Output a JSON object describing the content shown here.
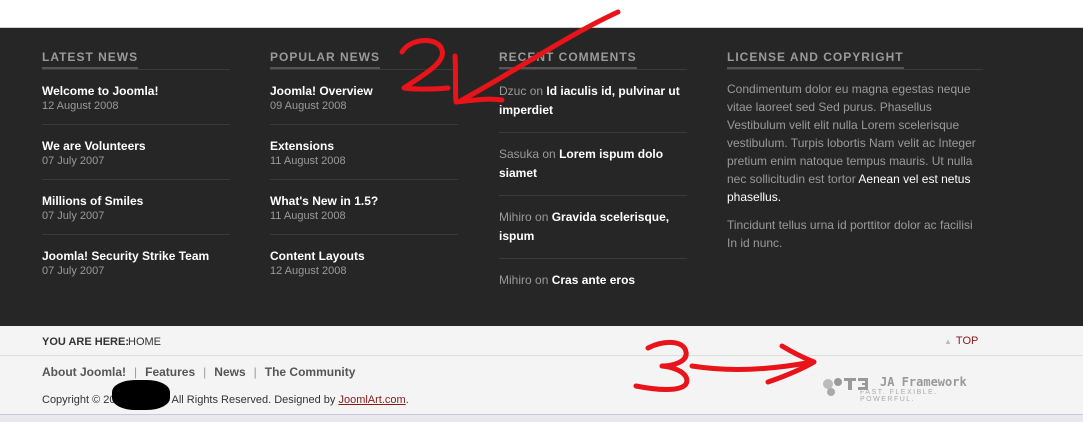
{
  "latest_news": {
    "heading": "LATEST NEWS",
    "items": [
      {
        "title": "Welcome to Joomla!",
        "date": "12 August 2008"
      },
      {
        "title": "We are Volunteers",
        "date": "07 July 2007"
      },
      {
        "title": "Millions of Smiles",
        "date": "07 July 2007"
      },
      {
        "title": "Joomla! Security Strike Team",
        "date": "07 July 2007"
      }
    ]
  },
  "popular_news": {
    "heading": "POPULAR NEWS",
    "items": [
      {
        "title": "Joomla! Overview",
        "date": "09 August 2008"
      },
      {
        "title": "Extensions",
        "date": "11 August 2008"
      },
      {
        "title": "What's New in 1.5?",
        "date": "11 August 2008"
      },
      {
        "title": "Content Layouts",
        "date": "12 August 2008"
      }
    ]
  },
  "recent_comments": {
    "heading": "RECENT COMMENTS",
    "items": [
      {
        "author": "Dzuc",
        "on": "on",
        "title": "Id iaculis id, pulvinar ut imperdiet"
      },
      {
        "author": "Sasuka",
        "on": "on",
        "title": "Lorem ispum dolo siamet"
      },
      {
        "author": "Mihiro",
        "on": "on",
        "title": "Gravida scelerisque, ispum"
      },
      {
        "author": "Mihiro",
        "on": "on",
        "title": "Cras ante eros"
      }
    ]
  },
  "license": {
    "heading": "LICENSE AND COPYRIGHT",
    "para1_text": "Condimentum dolor eu magna egestas neque vitae laoreet sed Sed purus. Phasellus Vestibulum velit elit nulla Lorem scelerisque vestibulum. Turpis lobortis Nam velit ac Integer pretium enim natoque tempus mauris. Ut nulla nec sollicitudin est tortor",
    "para1_highlight": "Aenean vel est netus phasellus.",
    "para2": "Tincidunt tellus urna id porttitor dolor ac facilisi In id nunc."
  },
  "breadcrumb": {
    "label": "YOU ARE HERE:",
    "home": "HOME",
    "top_link": "TOP"
  },
  "footer": {
    "nav": [
      "About Joomla!",
      "Features",
      "News",
      "The Community"
    ],
    "copyright_prefix": "Copyright © 20",
    "copyright_suffix": "All Rights Reserved. Designed by",
    "designer_link": "JoomlArt.com",
    "period": "."
  },
  "ja_framework": {
    "name": "JA Framework",
    "tagline": "FAST. FLEXIBLE. POWERFUL."
  },
  "annotations": {
    "label_2": "2",
    "label_3": "3",
    "color": "#e8141a"
  },
  "colors": {
    "dark_bg": "#262626",
    "accent_link": "#8a1a1a",
    "muted_text": "#9a9a9a"
  }
}
